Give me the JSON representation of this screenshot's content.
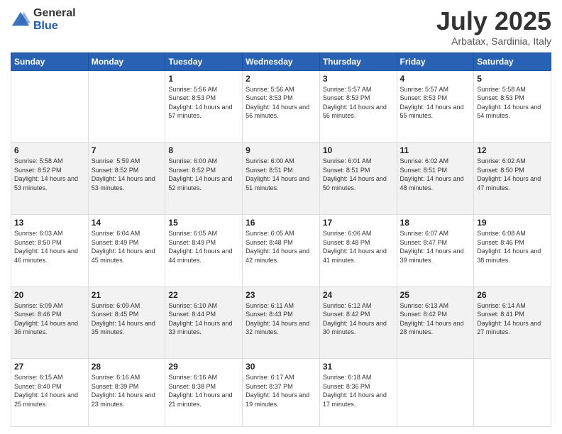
{
  "logo": {
    "general": "General",
    "blue": "Blue"
  },
  "header": {
    "month": "July 2025",
    "location": "Arbatax, Sardinia, Italy"
  },
  "weekdays": [
    "Sunday",
    "Monday",
    "Tuesday",
    "Wednesday",
    "Thursday",
    "Friday",
    "Saturday"
  ],
  "weeks": [
    [
      {
        "day": "",
        "sunrise": "",
        "sunset": "",
        "daylight": ""
      },
      {
        "day": "",
        "sunrise": "",
        "sunset": "",
        "daylight": ""
      },
      {
        "day": "1",
        "sunrise": "Sunrise: 5:56 AM",
        "sunset": "Sunset: 8:53 PM",
        "daylight": "Daylight: 14 hours and 57 minutes."
      },
      {
        "day": "2",
        "sunrise": "Sunrise: 5:56 AM",
        "sunset": "Sunset: 8:53 PM",
        "daylight": "Daylight: 14 hours and 56 minutes."
      },
      {
        "day": "3",
        "sunrise": "Sunrise: 5:57 AM",
        "sunset": "Sunset: 8:53 PM",
        "daylight": "Daylight: 14 hours and 56 minutes."
      },
      {
        "day": "4",
        "sunrise": "Sunrise: 5:57 AM",
        "sunset": "Sunset: 8:53 PM",
        "daylight": "Daylight: 14 hours and 55 minutes."
      },
      {
        "day": "5",
        "sunrise": "Sunrise: 5:58 AM",
        "sunset": "Sunset: 8:53 PM",
        "daylight": "Daylight: 14 hours and 54 minutes."
      }
    ],
    [
      {
        "day": "6",
        "sunrise": "Sunrise: 5:58 AM",
        "sunset": "Sunset: 8:52 PM",
        "daylight": "Daylight: 14 hours and 53 minutes."
      },
      {
        "day": "7",
        "sunrise": "Sunrise: 5:59 AM",
        "sunset": "Sunset: 8:52 PM",
        "daylight": "Daylight: 14 hours and 53 minutes."
      },
      {
        "day": "8",
        "sunrise": "Sunrise: 6:00 AM",
        "sunset": "Sunset: 8:52 PM",
        "daylight": "Daylight: 14 hours and 52 minutes."
      },
      {
        "day": "9",
        "sunrise": "Sunrise: 6:00 AM",
        "sunset": "Sunset: 8:51 PM",
        "daylight": "Daylight: 14 hours and 51 minutes."
      },
      {
        "day": "10",
        "sunrise": "Sunrise: 6:01 AM",
        "sunset": "Sunset: 8:51 PM",
        "daylight": "Daylight: 14 hours and 50 minutes."
      },
      {
        "day": "11",
        "sunrise": "Sunrise: 6:02 AM",
        "sunset": "Sunset: 8:51 PM",
        "daylight": "Daylight: 14 hours and 48 minutes."
      },
      {
        "day": "12",
        "sunrise": "Sunrise: 6:02 AM",
        "sunset": "Sunset: 8:50 PM",
        "daylight": "Daylight: 14 hours and 47 minutes."
      }
    ],
    [
      {
        "day": "13",
        "sunrise": "Sunrise: 6:03 AM",
        "sunset": "Sunset: 8:50 PM",
        "daylight": "Daylight: 14 hours and 46 minutes."
      },
      {
        "day": "14",
        "sunrise": "Sunrise: 6:04 AM",
        "sunset": "Sunset: 8:49 PM",
        "daylight": "Daylight: 14 hours and 45 minutes."
      },
      {
        "day": "15",
        "sunrise": "Sunrise: 6:05 AM",
        "sunset": "Sunset: 8:49 PM",
        "daylight": "Daylight: 14 hours and 44 minutes."
      },
      {
        "day": "16",
        "sunrise": "Sunrise: 6:05 AM",
        "sunset": "Sunset: 8:48 PM",
        "daylight": "Daylight: 14 hours and 42 minutes."
      },
      {
        "day": "17",
        "sunrise": "Sunrise: 6:06 AM",
        "sunset": "Sunset: 8:48 PM",
        "daylight": "Daylight: 14 hours and 41 minutes."
      },
      {
        "day": "18",
        "sunrise": "Sunrise: 6:07 AM",
        "sunset": "Sunset: 8:47 PM",
        "daylight": "Daylight: 14 hours and 39 minutes."
      },
      {
        "day": "19",
        "sunrise": "Sunrise: 6:08 AM",
        "sunset": "Sunset: 8:46 PM",
        "daylight": "Daylight: 14 hours and 38 minutes."
      }
    ],
    [
      {
        "day": "20",
        "sunrise": "Sunrise: 6:09 AM",
        "sunset": "Sunset: 8:46 PM",
        "daylight": "Daylight: 14 hours and 36 minutes."
      },
      {
        "day": "21",
        "sunrise": "Sunrise: 6:09 AM",
        "sunset": "Sunset: 8:45 PM",
        "daylight": "Daylight: 14 hours and 35 minutes."
      },
      {
        "day": "22",
        "sunrise": "Sunrise: 6:10 AM",
        "sunset": "Sunset: 8:44 PM",
        "daylight": "Daylight: 14 hours and 33 minutes."
      },
      {
        "day": "23",
        "sunrise": "Sunrise: 6:11 AM",
        "sunset": "Sunset: 8:43 PM",
        "daylight": "Daylight: 14 hours and 32 minutes."
      },
      {
        "day": "24",
        "sunrise": "Sunrise: 6:12 AM",
        "sunset": "Sunset: 8:42 PM",
        "daylight": "Daylight: 14 hours and 30 minutes."
      },
      {
        "day": "25",
        "sunrise": "Sunrise: 6:13 AM",
        "sunset": "Sunset: 8:42 PM",
        "daylight": "Daylight: 14 hours and 28 minutes."
      },
      {
        "day": "26",
        "sunrise": "Sunrise: 6:14 AM",
        "sunset": "Sunset: 8:41 PM",
        "daylight": "Daylight: 14 hours and 27 minutes."
      }
    ],
    [
      {
        "day": "27",
        "sunrise": "Sunrise: 6:15 AM",
        "sunset": "Sunset: 8:40 PM",
        "daylight": "Daylight: 14 hours and 25 minutes."
      },
      {
        "day": "28",
        "sunrise": "Sunrise: 6:16 AM",
        "sunset": "Sunset: 8:39 PM",
        "daylight": "Daylight: 14 hours and 23 minutes."
      },
      {
        "day": "29",
        "sunrise": "Sunrise: 6:16 AM",
        "sunset": "Sunset: 8:38 PM",
        "daylight": "Daylight: 14 hours and 21 minutes."
      },
      {
        "day": "30",
        "sunrise": "Sunrise: 6:17 AM",
        "sunset": "Sunset: 8:37 PM",
        "daylight": "Daylight: 14 hours and 19 minutes."
      },
      {
        "day": "31",
        "sunrise": "Sunrise: 6:18 AM",
        "sunset": "Sunset: 8:36 PM",
        "daylight": "Daylight: 14 hours and 17 minutes."
      },
      {
        "day": "",
        "sunrise": "",
        "sunset": "",
        "daylight": ""
      },
      {
        "day": "",
        "sunrise": "",
        "sunset": "",
        "daylight": ""
      }
    ]
  ]
}
